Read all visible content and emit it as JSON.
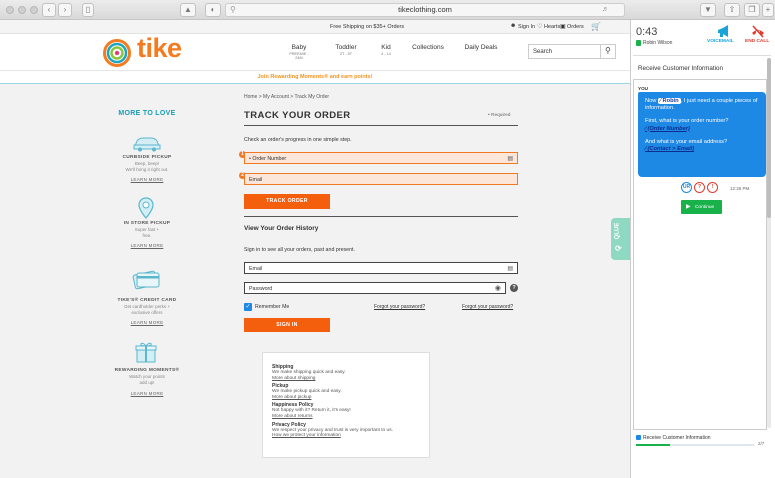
{
  "browser": {
    "url": "tikeclothing.com"
  },
  "site": {
    "promo": "Free Shipping on $35+ Orders",
    "signin": "Sign In",
    "hearts": "Hearts",
    "orders": "Orders",
    "logo": "tike",
    "nav": [
      {
        "label": "Baby",
        "sub": "PREEMIE - 24M"
      },
      {
        "label": "Toddler",
        "sub": "2T - 5T"
      },
      {
        "label": "Kid",
        "sub": "4 - 14"
      },
      {
        "label": "Collections",
        "sub": ""
      },
      {
        "label": "Daily Deals",
        "sub": ""
      }
    ],
    "search_placeholder": "Search",
    "join": "Join Rewarding Moments® and earn points!"
  },
  "sidebar": {
    "title": "MORE TO LOVE",
    "items": [
      {
        "title": "CURBSIDE PICKUP",
        "desc1": "Beep, beep!",
        "desc2": "We'll bring it right out.",
        "link": "LEARN MORE"
      },
      {
        "title": "IN STORE PICKUP",
        "desc1": "Super fast +",
        "desc2": "free.",
        "link": "LEARN MORE"
      },
      {
        "title": "TIKE'S® CREDIT CARD",
        "desc1": "Get cardholder perks +",
        "desc2": "exclusive offers",
        "link": "LEARN MORE"
      },
      {
        "title": "REWARDING MOMENTS®",
        "desc1": "Watch your points",
        "desc2": "add up!",
        "link": "LEARN MORE"
      }
    ]
  },
  "main": {
    "breadcrumb": "Home > My Account > Track My Order",
    "title": "TRACK YOUR ORDER",
    "required": "• Required",
    "intro": "Check an order's progress in one simple step.",
    "order_number_placeholder": "• Order Number",
    "email_placeholder": "Email",
    "track_button": "TRACK ORDER",
    "history_title": "View Your Order History",
    "history_intro": "Sign in to see all your orders, past and present.",
    "history_email": "Email",
    "history_password": "Password",
    "remember": "Remember Me",
    "forgot1": "Forgot your password?",
    "forgot2": "Forgot your password?",
    "signin_button": "SIGN IN",
    "info": [
      {
        "h": "Shipping",
        "t": "We make shipping quick and easy.",
        "l": "More about shipping"
      },
      {
        "h": "Pickup",
        "t": "We make pickup quick and easy.",
        "l": "More about pickup"
      },
      {
        "h": "Happiness Policy",
        "t": "Not happy with it? Return it, it's easy!",
        "l": "More about returns"
      },
      {
        "h": "Privacy Policy",
        "t": "We respect your privacy and trust is very important to us.",
        "l": "How we protect your information"
      }
    ],
    "markers": [
      "1",
      "2"
    ]
  },
  "qlue": "QLUE",
  "panel": {
    "timer": "0:43",
    "agent": "Robin Wilson",
    "voicemail": "VOICEMAIL",
    "end_call": "END CALL",
    "section_title": "Receive Customer Information",
    "you": "YOU",
    "msg": {
      "p1_pre": "Now ",
      "p1_chip": "∕ Robin",
      "p1_post": ", I just need a couple pieces of information.",
      "p2": "First, what is your order number?",
      "p2_ph": "∕ (Order Number)",
      "p3": "And what is your email address?",
      "p3_ph": "∕ (Contact > Email)"
    },
    "chips": [
      "UR",
      "?",
      "!"
    ],
    "time": "12:26 PM",
    "continue": "Continue",
    "bottom_status": "Receive Customer Information",
    "progress_text": "2/7",
    "progress": 0.29
  },
  "colors": {
    "brand_orange": "#f35f0d",
    "teal": "#189db4",
    "chat_blue": "#1e88e5",
    "green": "#19b14a",
    "end_red": "#e23b2f"
  }
}
